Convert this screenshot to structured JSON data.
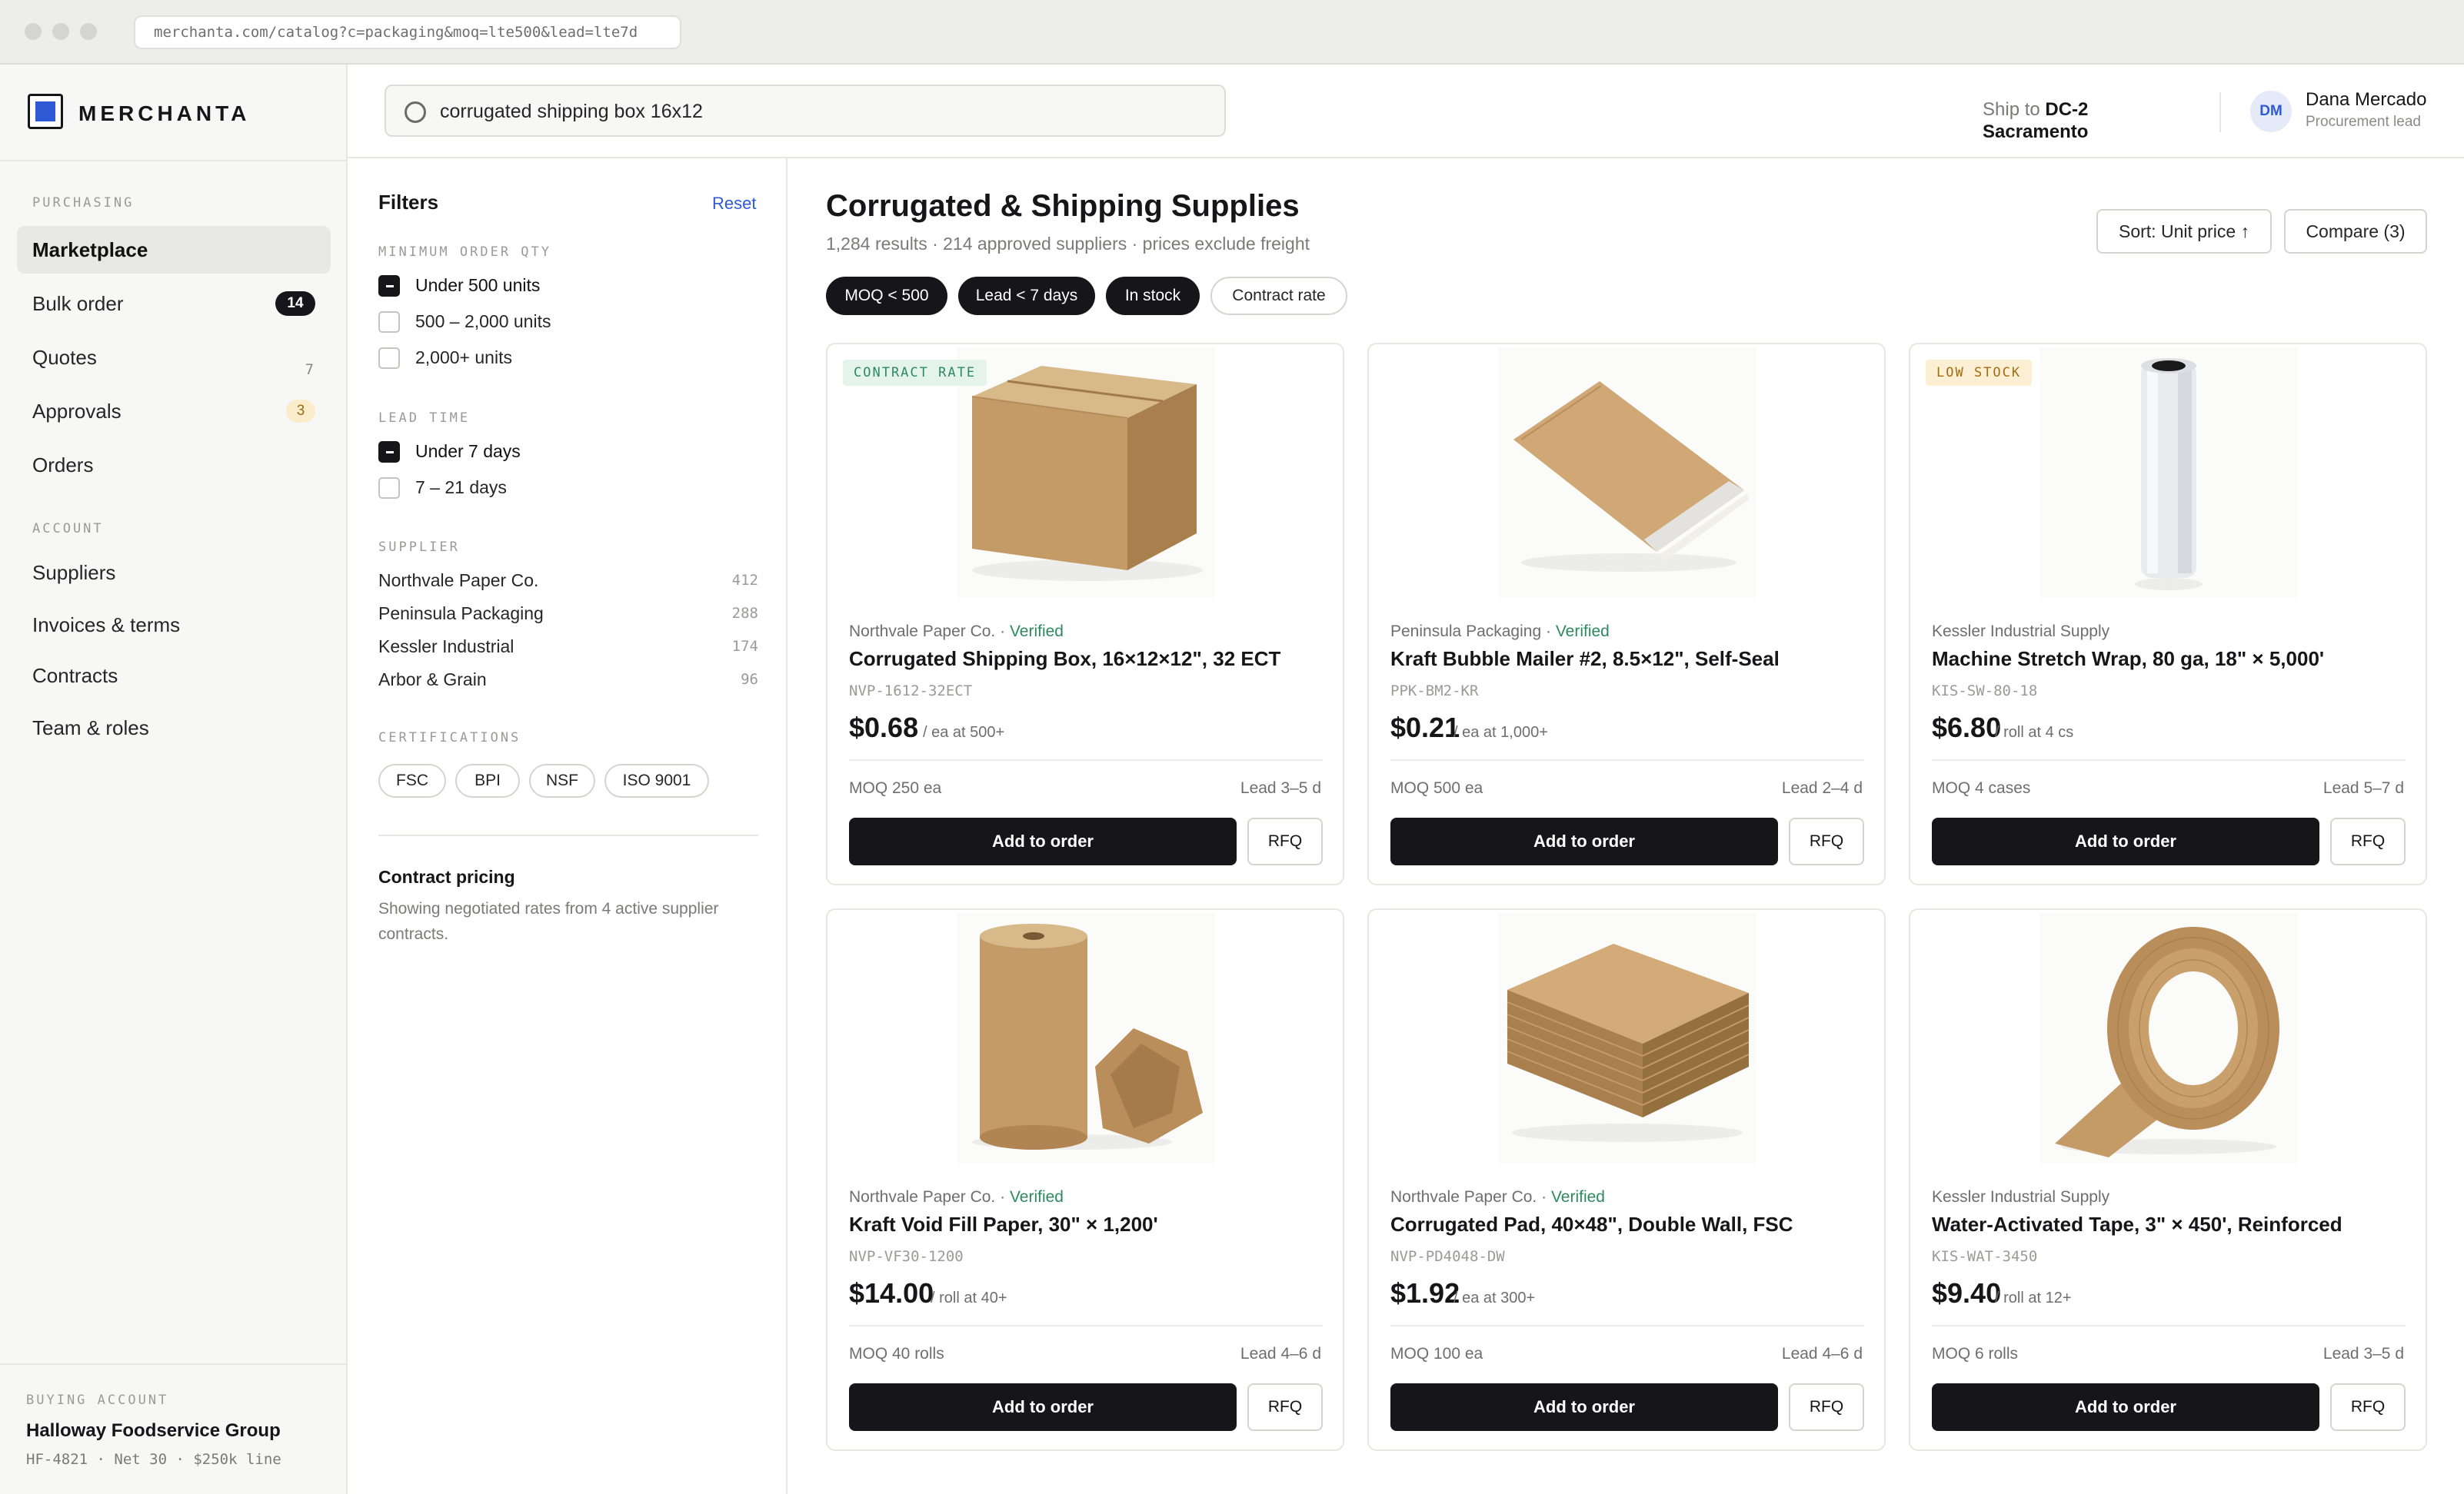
{
  "browser": {
    "url": "merchanta.com/catalog?c=packaging&moq=lte500&lead=lte7d"
  },
  "brand": {
    "name": "MERCHANTA"
  },
  "sidebar": {
    "section_purchasing": "PURCHASING",
    "section_account": "ACCOUNT",
    "items": [
      {
        "label": "Marketplace",
        "badge": ""
      },
      {
        "label": "Bulk order",
        "badge": "14"
      },
      {
        "label": "Quotes",
        "badge": "7"
      },
      {
        "label": "Approvals",
        "badge": "3"
      },
      {
        "label": "Orders",
        "badge": ""
      },
      {
        "label": "Suppliers",
        "badge": ""
      },
      {
        "label": "Invoices & terms",
        "badge": ""
      },
      {
        "label": "Contracts",
        "badge": ""
      },
      {
        "label": "Team & roles",
        "badge": ""
      }
    ],
    "account": {
      "label": "BUYING ACCOUNT",
      "name": "Halloway Foodservice Group",
      "meta": "HF-4821 · Net 30 · $250k line"
    }
  },
  "topbar": {
    "search_value": "corrugated shipping box 16x12",
    "ship_prefix": "Ship to",
    "ship_code": "DC-2",
    "ship_city": "Sacramento",
    "user_initials": "DM",
    "user_name": "Dana Mercado",
    "user_role": "Procurement lead"
  },
  "filters": {
    "title": "Filters",
    "reset": "Reset",
    "moq_label": "MINIMUM ORDER QTY",
    "moq_options": [
      {
        "label": "Under 500 units",
        "checked": true
      },
      {
        "label": "500 – 2,000 units",
        "checked": false
      },
      {
        "label": "2,000+ units",
        "checked": false
      }
    ],
    "lead_label": "LEAD TIME",
    "lead_options": [
      {
        "label": "Under 7 days",
        "checked": true
      },
      {
        "label": "7 – 21 days",
        "checked": false
      }
    ],
    "supplier_label": "SUPPLIER",
    "suppliers": [
      {
        "name": "Northvale Paper Co.",
        "count": "412"
      },
      {
        "name": "Peninsula Packaging",
        "count": "288"
      },
      {
        "name": "Kessler Industrial",
        "count": "174"
      },
      {
        "name": "Arbor & Grain",
        "count": "96"
      }
    ],
    "cert_label": "CERTIFICATIONS",
    "certs": [
      "FSC",
      "BPI",
      "NSF",
      "ISO 9001"
    ],
    "contract_title": "Contract pricing",
    "contract_body": "Showing negotiated rates from 4 active supplier contracts."
  },
  "main": {
    "title": "Corrugated & Shipping Supplies",
    "subtitle": "1,284 results · 214 approved suppliers · prices exclude freight",
    "sort_label": "Sort: Unit price ↑",
    "compare_label": "Compare (3)",
    "chips": [
      {
        "label": "MOQ < 500",
        "active": true
      },
      {
        "label": "Lead < 7 days",
        "active": true
      },
      {
        "label": "In stock",
        "active": true
      },
      {
        "label": "Contract rate",
        "active": false
      }
    ],
    "add_label": "Add to order",
    "rfq_label": "RFQ",
    "products": [
      {
        "tag": "CONTRACT RATE",
        "tag_color": "#2e8a60",
        "vendor": "Northvale Paper Co.",
        "verified": "Verified",
        "name": "Corrugated Shipping Box, 16×12×12\", 32 ECT",
        "sku": "NVP-1612-32ECT",
        "price": "$0.68",
        "unit": "/ ea at 500+",
        "moq": "MOQ 250 ea",
        "lead": "Lead 3–5 d",
        "image": "box-image"
      },
      {
        "tag": "",
        "tag_color": "",
        "vendor": "Peninsula Packaging",
        "verified": "Verified",
        "name": "Kraft Bubble Mailer #2, 8.5×12\", Self-Seal",
        "sku": "PPK-BM2-KR",
        "price": "$0.21",
        "unit": "/ ea at 1,000+",
        "moq": "MOQ 500 ea",
        "lead": "Lead 2–4 d",
        "image": "mailer-image"
      },
      {
        "tag": "LOW STOCK",
        "tag_color": "#a36c12",
        "vendor": "Kessler Industrial Supply",
        "verified": "",
        "name": "Machine Stretch Wrap, 80 ga, 18\" × 5,000'",
        "sku": "KIS-SW-80-18",
        "price": "$6.80",
        "unit": "/ roll at 4 cs",
        "moq": "MOQ 4 cases",
        "lead": "Lead 5–7 d",
        "image": "stretch-wrap-image"
      },
      {
        "tag": "",
        "tag_color": "",
        "vendor": "Northvale Paper Co.",
        "verified": "Verified",
        "name": "Kraft Void Fill Paper, 30\" × 1,200'",
        "sku": "NVP-VF30-1200",
        "price": "$14.00",
        "unit": "/ roll at 40+",
        "moq": "MOQ 40 rolls",
        "lead": "Lead 4–6 d",
        "image": "kraft-roll-image"
      },
      {
        "tag": "",
        "tag_color": "",
        "vendor": "Northvale Paper Co.",
        "verified": "Verified",
        "name": "Corrugated Pad, 40×48\", Double Wall, FSC",
        "sku": "NVP-PD4048-DW",
        "price": "$1.92",
        "unit": "/ ea at 300+",
        "moq": "MOQ 100 ea",
        "lead": "Lead 4–6 d",
        "image": "pad-stack-image"
      },
      {
        "tag": "",
        "tag_color": "",
        "vendor": "Kessler Industrial Supply",
        "verified": "",
        "name": "Water-Activated Tape, 3\" × 450', Reinforced",
        "sku": "KIS-WAT-3450",
        "price": "$9.40",
        "unit": "/ roll at 12+",
        "moq": "MOQ 6 rolls",
        "lead": "Lead 3–5 d",
        "image": "tape-roll-image"
      }
    ]
  },
  "colors": {
    "accent": "#2f5ad6",
    "ink": "#16161a",
    "verified": "#2e8a60",
    "kraft": "#c49a66"
  }
}
